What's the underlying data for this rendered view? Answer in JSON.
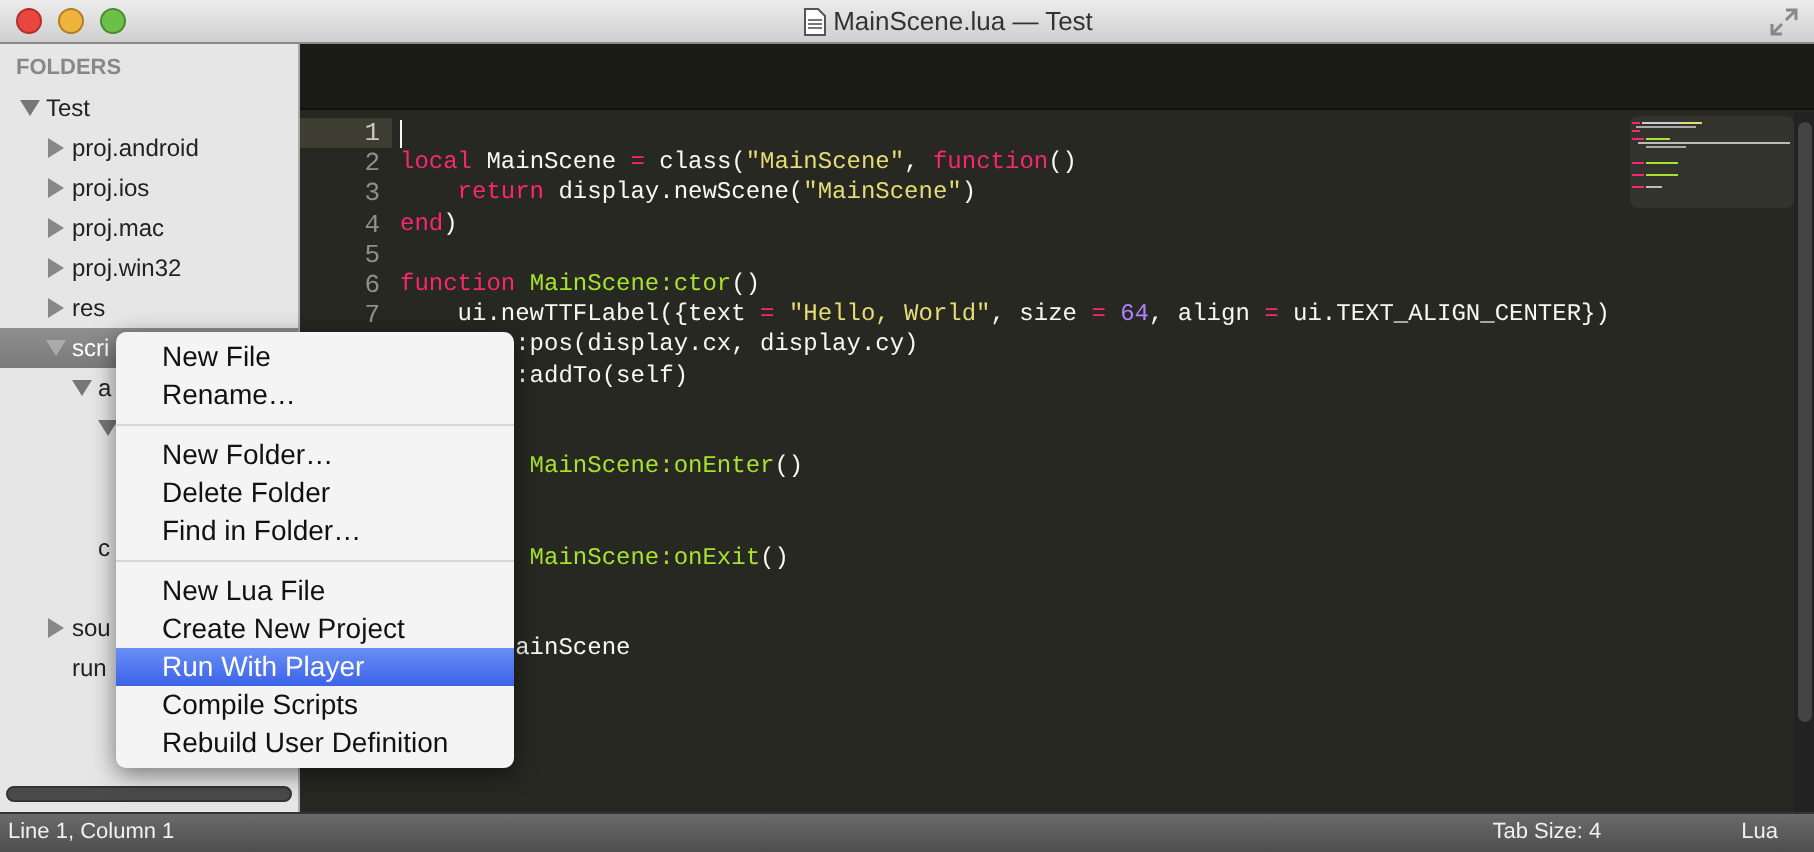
{
  "window": {
    "title": "MainScene.lua — Test"
  },
  "sidebar": {
    "heading": "FOLDERS",
    "tree": [
      {
        "name": "Test",
        "kind": "folder",
        "expanded": true,
        "selected": false,
        "children": [
          {
            "name": "proj.android",
            "kind": "folder",
            "expanded": false,
            "selected": false
          },
          {
            "name": "proj.ios",
            "kind": "folder",
            "expanded": false,
            "selected": false
          },
          {
            "name": "proj.mac",
            "kind": "folder",
            "expanded": false,
            "selected": false
          },
          {
            "name": "proj.win32",
            "kind": "folder",
            "expanded": false,
            "selected": false
          },
          {
            "name": "res",
            "kind": "folder",
            "expanded": false,
            "selected": false
          },
          {
            "name": "scri",
            "kind": "folder",
            "expanded": true,
            "selected": true,
            "children": [
              {
                "name": "a",
                "kind": "folder",
                "expanded": true,
                "selected": false,
                "children": [
                  {
                    "kind": "folder",
                    "expanded": true,
                    "selected": false,
                    "children": [
                      {
                        "selected": false
                      },
                      {
                        "selected": false
                      }
                    ]
                  }
                ]
              },
              {
                "name": "c",
                "kind": "file",
                "selected": false
              },
              {
                "kind": "file",
                "selected": false
              }
            ]
          },
          {
            "name": "sou",
            "kind": "folder",
            "expanded": false,
            "selected": false
          },
          {
            "name": "run",
            "kind": "file",
            "selected": false
          }
        ]
      }
    ]
  },
  "editor": {
    "lines": [
      {
        "number": "1",
        "current": true
      },
      {
        "number": "2",
        "current": false,
        "tokens": [
          {
            "t": "local",
            "kind": "keyword"
          },
          {
            "t": " MainScene ",
            "kind": "plain"
          },
          {
            "t": "=",
            "kind": "keyword"
          },
          {
            "t": " class(",
            "kind": "plain"
          },
          {
            "t": "\"MainScene\"",
            "kind": "string"
          },
          {
            "t": ", ",
            "kind": "plain"
          },
          {
            "t": "function",
            "kind": "keyword"
          },
          {
            "t": "()",
            "kind": "plain"
          }
        ]
      },
      {
        "number": "3",
        "current": false,
        "tokens": [
          {
            "t": "    return",
            "kind": "keyword"
          },
          {
            "t": " display.newScene(",
            "kind": "plain"
          },
          {
            "t": "\"MainScene\"",
            "kind": "string"
          },
          {
            "t": ")",
            "kind": "plain"
          }
        ]
      },
      {
        "number": "4",
        "current": false,
        "tokens": [
          {
            "t": "end",
            "kind": "keyword"
          },
          {
            "t": ")",
            "kind": "plain"
          }
        ]
      },
      {
        "number": "5",
        "current": false
      },
      {
        "number": "6",
        "current": false,
        "tokens": [
          {
            "t": "function ",
            "kind": "keyword"
          },
          {
            "t": "MainScene:ctor",
            "kind": "func"
          },
          {
            "t": "()",
            "kind": "plain"
          }
        ]
      },
      {
        "number": "7",
        "current": false,
        "tokens": [
          {
            "t": "    ui.newTTFLabel({text ",
            "kind": "plain"
          },
          {
            "t": "= ",
            "kind": "keyword"
          },
          {
            "t": "\"Hello, World\"",
            "kind": "string"
          },
          {
            "t": ", size ",
            "kind": "plain"
          },
          {
            "t": "= ",
            "kind": "keyword"
          },
          {
            "t": "64",
            "kind": "number"
          },
          {
            "t": ", align ",
            "kind": "plain"
          },
          {
            "t": "=",
            "kind": "keyword"
          },
          {
            "t": " ui.TEXT_ALIGN_CENTER})",
            "kind": "plain"
          }
        ]
      },
      {
        "tokens": [
          {
            "t": "        :pos(display.cx, display.cy)",
            "kind": "plain"
          }
        ]
      },
      {
        "tokens": [
          {
            "t": "        :addTo(self)",
            "kind": "plain"
          }
        ]
      },
      {
        "kind": "blank"
      },
      {
        "kind": "blank"
      },
      {
        "tokens": [
          {
            "t": "         MainScene:onEnter",
            "kind": "func"
          },
          {
            "t": "()",
            "kind": "plain"
          }
        ]
      },
      {
        "kind": "blank"
      },
      {
        "kind": "blank"
      },
      {
        "tokens": [
          {
            "t": "         MainScene:onExit",
            "kind": "func"
          },
          {
            "t": "()",
            "kind": "plain"
          }
        ]
      },
      {
        "kind": "blank"
      },
      {
        "kind": "blank"
      },
      {
        "tokens": [
          {
            "t": "        ainScene",
            "kind": "plain"
          }
        ]
      }
    ]
  },
  "context_menu": {
    "sections": [
      [
        {
          "label": "New File",
          "selected": false
        },
        {
          "label": "Rename…",
          "selected": false
        }
      ],
      [
        {
          "label": "New Folder…",
          "selected": false
        },
        {
          "label": "Delete Folder",
          "selected": false
        },
        {
          "label": "Find in Folder…",
          "selected": false
        }
      ],
      [
        {
          "label": "New Lua File",
          "selected": false
        },
        {
          "label": "Create New Project",
          "selected": false
        },
        {
          "label": "Run With Player",
          "selected": true
        },
        {
          "label": "Compile Scripts",
          "selected": false
        },
        {
          "label": "Rebuild User Definition",
          "selected": false
        }
      ]
    ]
  },
  "status_bar": {
    "position": "Line 1, Column 1",
    "tab_size": "Tab Size: 4",
    "syntax": "Lua"
  }
}
